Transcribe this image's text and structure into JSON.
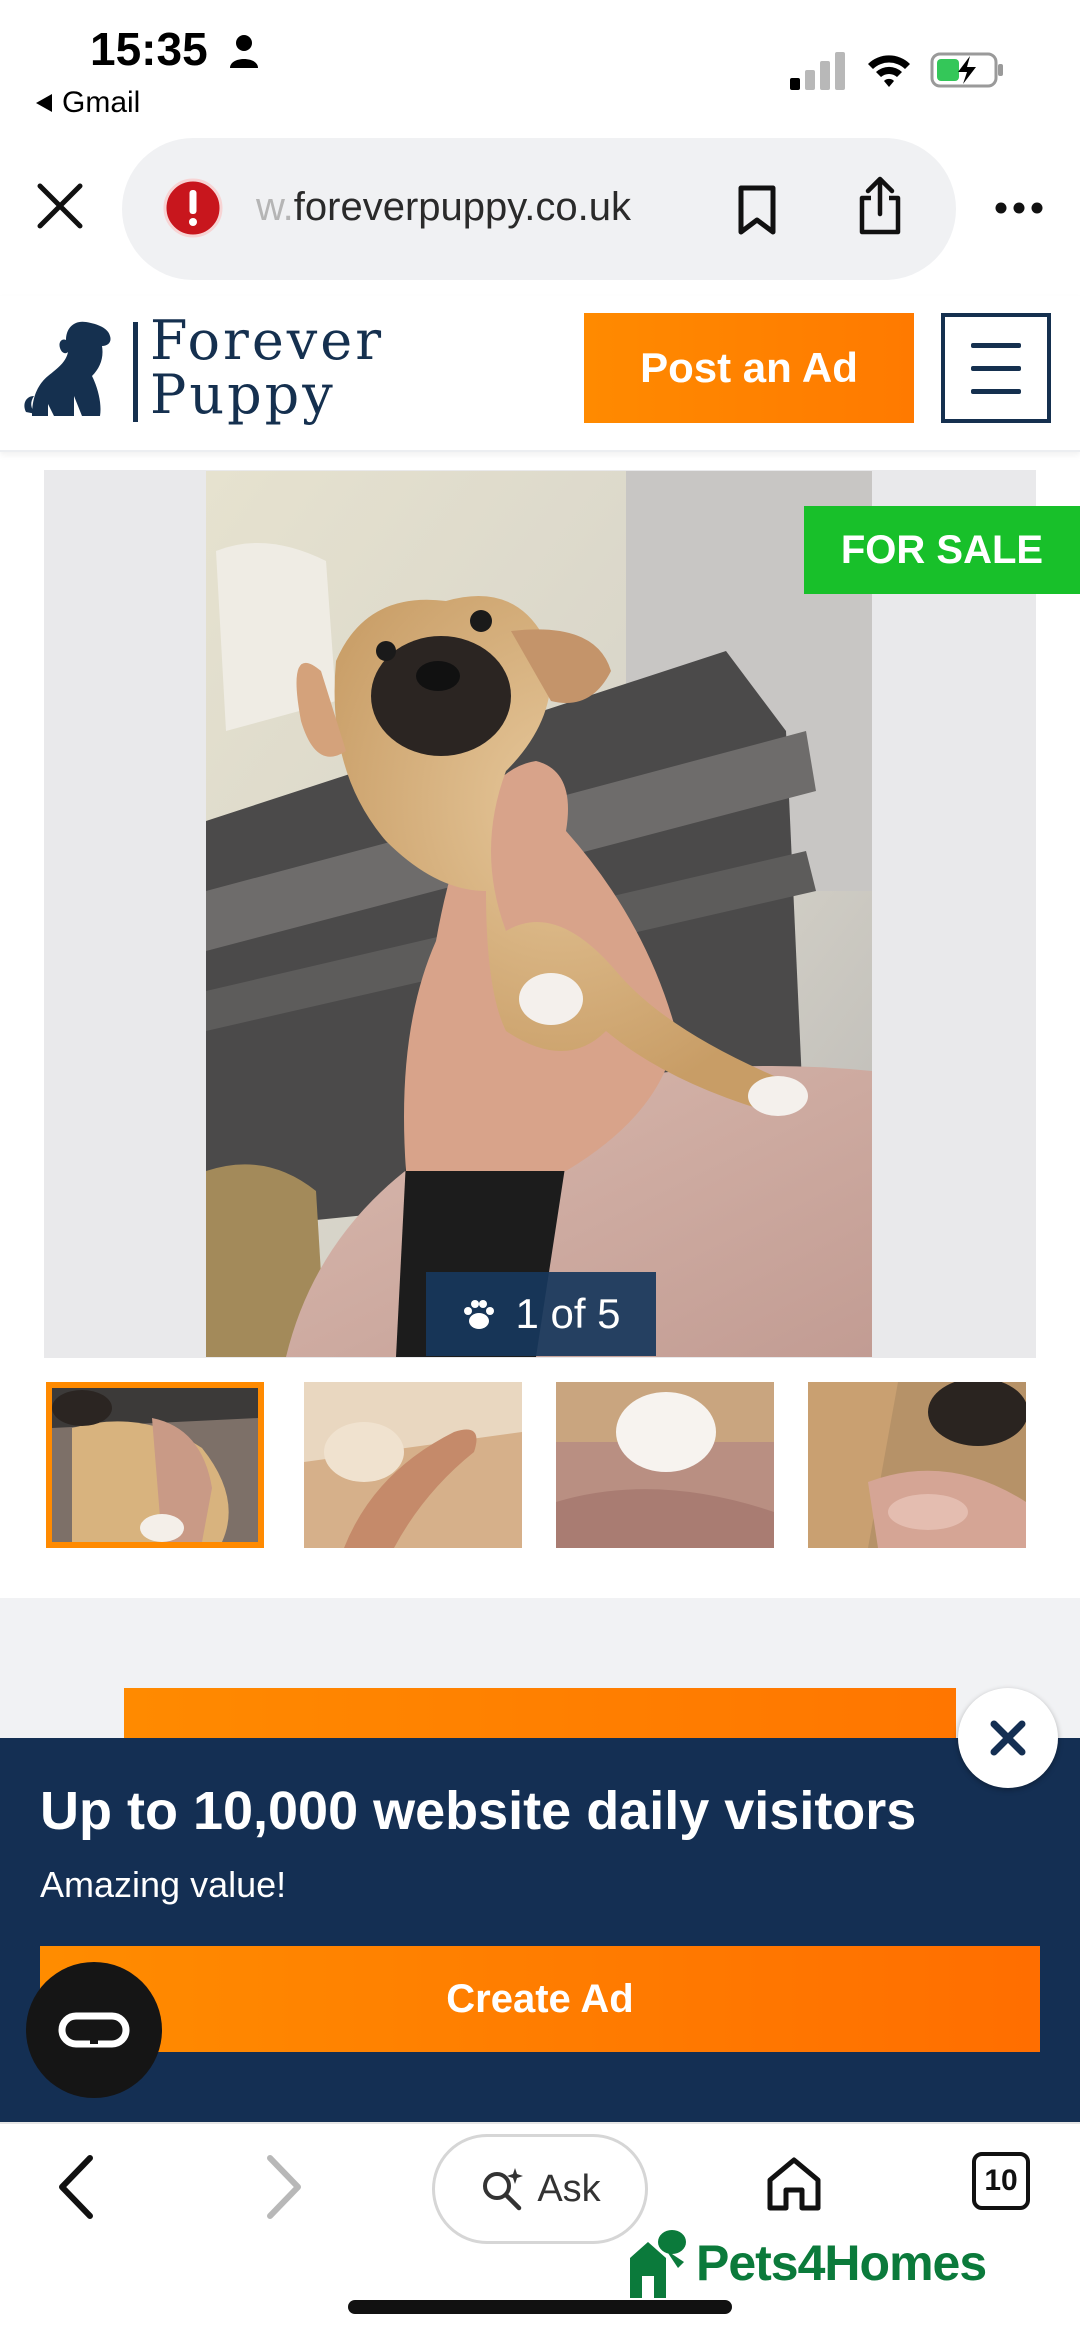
{
  "status_bar": {
    "time": "15:35",
    "back_app": "Gmail",
    "icons": [
      "person-icon",
      "cellular-signal-icon",
      "wifi-icon",
      "battery-charging-icon"
    ]
  },
  "browser": {
    "url_faded": "w.",
    "url": "foreverpuppy.co.uk",
    "icons": [
      "close-icon",
      "warning-icon",
      "bookmark-icon",
      "share-icon",
      "more-icon"
    ]
  },
  "site": {
    "logo_line1": "Forever",
    "logo_line2": "Puppy",
    "post_ad_label": "Post an Ad",
    "brand_color": "#15304f",
    "accent_color": "#ff8a00"
  },
  "gallery": {
    "badge": "FOR SALE",
    "counter": "1 of 5",
    "current_index": 1,
    "total": 5,
    "thumbnail_count": 4,
    "active_thumbnail": 1
  },
  "promo": {
    "title": "Up to 10,000 website daily visitors",
    "subtitle": "Amazing value!",
    "cta": "Create Ad"
  },
  "toolbar": {
    "ask_label": "Ask",
    "tab_count": "10",
    "icons": [
      "back-icon",
      "forward-icon",
      "sparkle-search-icon",
      "home-icon",
      "tabs-icon"
    ]
  },
  "watermark": {
    "text": "Pets4Homes"
  }
}
